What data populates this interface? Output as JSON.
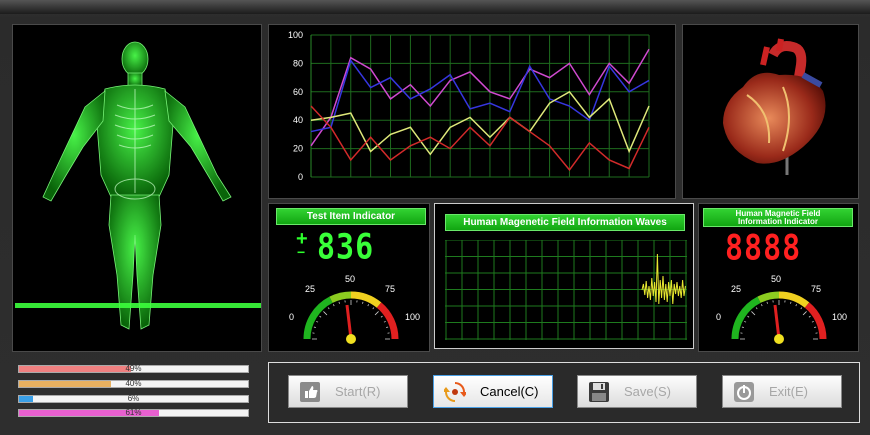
{
  "chart_data": {
    "type": "line",
    "x": [
      0,
      1,
      2,
      3,
      4,
      5,
      6,
      7,
      8,
      9,
      10,
      11,
      12,
      13,
      14,
      15,
      16,
      17
    ],
    "ylim": [
      0,
      100
    ],
    "yticks": [
      "0",
      "20",
      "40",
      "60",
      "80",
      "100"
    ],
    "grid": true,
    "series": [
      {
        "color": "#d04ad0",
        "values": [
          22,
          42,
          84,
          76,
          55,
          65,
          50,
          68,
          74,
          60,
          55,
          76,
          70,
          80,
          58,
          80,
          66,
          90
        ]
      },
      {
        "color": "#3636e0",
        "values": [
          32,
          35,
          82,
          63,
          70,
          55,
          62,
          72,
          48,
          52,
          46,
          78,
          55,
          50,
          40,
          78,
          60,
          68
        ]
      },
      {
        "color": "#dfe87a",
        "values": [
          40,
          42,
          45,
          18,
          30,
          35,
          16,
          35,
          42,
          28,
          42,
          32,
          52,
          60,
          42,
          55,
          18,
          50
        ]
      },
      {
        "color": "#d22a2a",
        "values": [
          50,
          35,
          12,
          28,
          12,
          22,
          28,
          20,
          35,
          22,
          42,
          32,
          22,
          5,
          24,
          12,
          6,
          35
        ]
      }
    ]
  },
  "test_item": {
    "title": "Test Item Indicator",
    "sign_plus": "+",
    "sign_minus": "−",
    "display": "836"
  },
  "waves_panel": {
    "title": "Human Magenetic  Field Information Waves"
  },
  "info_indicator": {
    "title_line1": "Human Magnetic Field",
    "title_line2": "Information Indicator",
    "display": "8888"
  },
  "gauge": {
    "labels": [
      "0",
      "25",
      "50",
      "75",
      "100"
    ]
  },
  "progress_bars": [
    {
      "label": "49%",
      "value": 0.49,
      "color": "#f08080"
    },
    {
      "label": "40%",
      "value": 0.4,
      "color": "#e8b060"
    },
    {
      "label": "6%",
      "value": 0.06,
      "color": "#3aa0e8"
    },
    {
      "label": "61%",
      "value": 0.61,
      "color": "#e860d0"
    }
  ],
  "buttons": {
    "start": "Start(R)",
    "cancel": "Cancel(C)",
    "save": "Save(S)",
    "exit": "Exit(E)"
  }
}
